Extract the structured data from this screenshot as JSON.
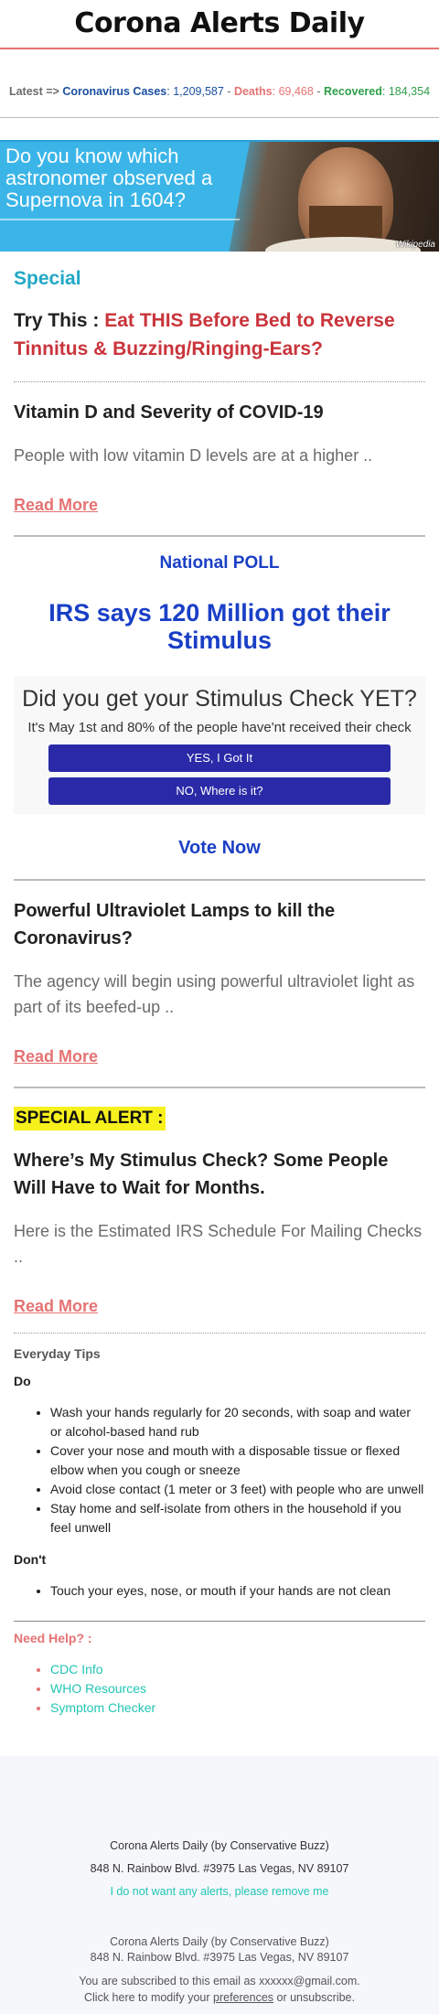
{
  "header": {
    "brand": "Corona Alerts Daily"
  },
  "ticker": {
    "latest": "Latest =>",
    "cases_label": "Coronavirus Cases",
    "cases_value": "1,209,587",
    "deaths_label": "Deaths",
    "deaths_value": "69,468",
    "recovered_label": "Recovered",
    "recovered_value": "184,354",
    "separator": " - "
  },
  "banner": {
    "question": "Do you know which astronomer observed a Supernova in 1604?",
    "tag": "Wikipedia"
  },
  "special": {
    "heading": "Special",
    "try_prefix": "Try This : ",
    "try_text": "Eat THIS Before Bed to Reverse Tinnitus & Buzzing/Ringing-Ears?"
  },
  "article1": {
    "title": "Vitamin D and Severity of COVID-19",
    "body": "People with low vitamin D levels are at a higher ..",
    "read_more": "Read More"
  },
  "poll": {
    "label": "National POLL",
    "headline": "IRS says 120 Million got their Stimulus",
    "card_title": "Did you get your Stimulus Check YET?",
    "card_sub": "It's May 1st and 80% of the people have'nt received their check",
    "yes_button": "YES, I Got It",
    "no_button": "NO, Where is it?",
    "vote": "Vote Now"
  },
  "article2": {
    "title": "Powerful Ultraviolet Lamps to kill the Coronavirus?",
    "body": "The agency will begin using powerful ultraviolet light as part of its beefed-up  ..",
    "read_more": "Read More"
  },
  "alert": {
    "badge": "SPECIAL ALERT :",
    "title": "Where’s My Stimulus Check? Some People Will Have to Wait for Months.",
    "body": "Here is the Estimated IRS Schedule For Mailing Checks ..",
    "read_more": "Read More"
  },
  "tips": {
    "heading": "Everyday Tips",
    "do_heading": "Do",
    "do_items": [
      "Wash your hands regularly for 20 seconds, with soap and water or alcohol-based hand rub",
      "Cover your nose and mouth with a disposable tissue or flexed elbow when you cough or sneeze",
      "Avoid close contact (1 meter or 3 feet) with people who are unwell",
      "Stay home and self-isolate from others in the household if you feel unwell"
    ],
    "dont_heading": "Don't",
    "dont_items": [
      "Touch your eyes, nose, or mouth if your hands are not clean"
    ]
  },
  "help": {
    "heading": "Need Help? :",
    "links": [
      "CDC Info",
      "WHO Resources",
      "Symptom Checker"
    ]
  },
  "footer": {
    "org": "Corona Alerts Daily (by Conservative Buzz)",
    "address": "848 N. Rainbow Blvd. #3975 Las Vegas, NV 89107",
    "unsubscribe_link": "I do not want any alerts, please remove me",
    "org2": "Corona Alerts Daily (by Conservative Buzz)",
    "address2": "848 N. Rainbow Blvd. #3975 Las Vegas, NV 89107",
    "subscribed": "You are subscribed to this email as xxxxxx@gmail.com.",
    "modify_prefix": "Click here to modify your ",
    "preferences": "preferences",
    "modify_suffix": " or unsubscribe."
  }
}
